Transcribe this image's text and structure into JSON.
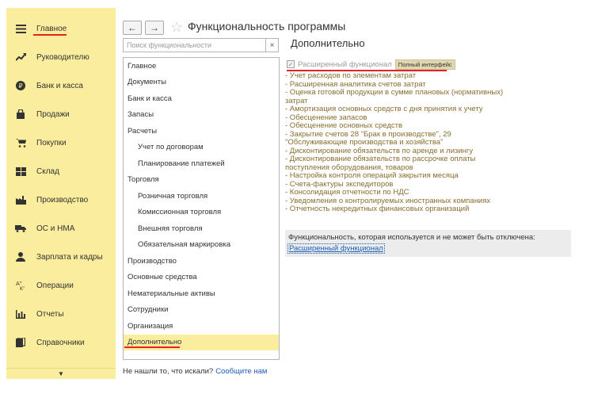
{
  "colors": {
    "sidebar_bg": "#fbed9e",
    "accent_underline": "#e5212a",
    "link": "#1c5fb5",
    "feature_text": "#8a6d2f"
  },
  "sidebar": {
    "items": [
      {
        "label": "Главное",
        "icon": "menu-icon",
        "active": true
      },
      {
        "label": "Руководителю",
        "icon": "trend-up-icon"
      },
      {
        "label": "Банк и касса",
        "icon": "coin-icon"
      },
      {
        "label": "Продажи",
        "icon": "bag-icon"
      },
      {
        "label": "Покупки",
        "icon": "cart-icon"
      },
      {
        "label": "Склад",
        "icon": "warehouse-icon"
      },
      {
        "label": "Производство",
        "icon": "factory-icon"
      },
      {
        "label": "ОС и НМА",
        "icon": "truck-icon"
      },
      {
        "label": "Зарплата и кадры",
        "icon": "person-icon"
      },
      {
        "label": "Операции",
        "icon": "operations-icon"
      },
      {
        "label": "Отчеты",
        "icon": "bar-chart-icon"
      },
      {
        "label": "Справочники",
        "icon": "book-icon"
      }
    ],
    "scroll_down": "▼"
  },
  "header": {
    "back": "←",
    "forward": "→",
    "star": "☆",
    "title": "Функциональность программы"
  },
  "search": {
    "placeholder": "Поиск функциональности",
    "clear": "×"
  },
  "sections": [
    {
      "label": "Главное",
      "level": 0
    },
    {
      "label": "Документы",
      "level": 0
    },
    {
      "label": "Банк и касса",
      "level": 0
    },
    {
      "label": "Запасы",
      "level": 0
    },
    {
      "label": "Расчеты",
      "level": 0
    },
    {
      "label": "Учет по договорам",
      "level": 1
    },
    {
      "label": "Планирование платежей",
      "level": 1
    },
    {
      "label": "Торговля",
      "level": 0
    },
    {
      "label": "Розничная торговля",
      "level": 1
    },
    {
      "label": "Комиссионная торговля",
      "level": 1
    },
    {
      "label": "Внешняя торговля",
      "level": 1
    },
    {
      "label": "Обязательная маркировка",
      "level": 1
    },
    {
      "label": "Производство",
      "level": 0
    },
    {
      "label": "Основные средства",
      "level": 0
    },
    {
      "label": "Нематериальные активы",
      "level": 0
    },
    {
      "label": "Сотрудники",
      "level": 0
    },
    {
      "label": "Организация",
      "level": 0
    },
    {
      "label": "Дополнительно",
      "level": 0,
      "active": true
    }
  ],
  "not_found": {
    "text": "Не нашли то, что искали?",
    "link": "Сообщите нам"
  },
  "panel": {
    "title": "Дополнительно",
    "extended": {
      "checked": true,
      "label": "Расширенный функционал",
      "badge": "Полный интерфейс"
    },
    "features": [
      "- Учет расходов по элементам затрат",
      "- Расширенная аналитика счетов затрат",
      "- Оценка готовой продукции в сумме плановых (нормативных)",
      "затрат",
      "- Амортизация основных средств с дня принятия к учету",
      "- Обесценение запасов",
      "- Обесценение основных средств",
      "- Закрытие счетов 28 \"Брак в производстве\", 29",
      "\"Обслуживающие производства и хозяйства\"",
      "- Дисконтирование обязательств по аренде и лизингу",
      "- Дисконтирование обязательств по рассрочке оплаты",
      "поступления оборудования, товаров",
      "- Настройка контроля операций закрытия месяца",
      "- Счета-фактуры экспедиторов",
      "- Консолидация отчетности по НДС",
      "- Уведомления о контролируемых иностранных компаниях",
      "- Отчетность некредитных финансовых организаций"
    ],
    "always_text": "Функциональность, которая используется и не может быть отключена:",
    "always_link": "Расширенный функционал"
  }
}
